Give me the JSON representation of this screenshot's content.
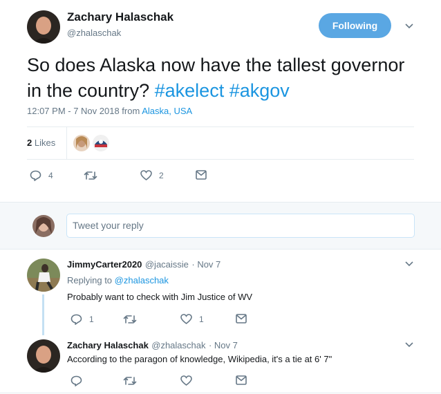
{
  "tweet": {
    "author_name": "Zachary Halaschak",
    "author_handle": "@zhalaschak",
    "follow_label": "Following",
    "text_plain": "So does Alaska now have the tallest governor in the country?",
    "hashtag_1": "#akelect",
    "hashtag_2": "#akgov",
    "timestamp": "12:07 PM - 7 Nov 2018 from",
    "location": "Alaska, USA",
    "likes_count": "2",
    "likes_label": "Likes",
    "reply_count": "4",
    "like_count": "2"
  },
  "reply_box": {
    "placeholder": "Tweet your reply"
  },
  "replies": [
    {
      "name": "JimmyCarter2020",
      "handle": "@jacaissie",
      "date": "· Nov 7",
      "replying_to_label": "Replying to",
      "replying_to": "@zhalaschak",
      "text": "Probably want to check with Jim Justice of WV",
      "reply_count": "1",
      "like_count": "1"
    },
    {
      "name": "Zachary Halaschak",
      "handle": "@zhalaschak",
      "date": "· Nov 7",
      "text": "According to the paragon of knowledge, Wikipedia, it's a tie at 6' 7\""
    }
  ],
  "colors": {
    "accent": "#1b95e0",
    "follow_bg": "#5aa7e3",
    "muted": "#657786",
    "divider": "#e6ecf0"
  },
  "icons": [
    "reply-icon",
    "retweet-icon",
    "heart-icon",
    "message-icon",
    "chevron-down-icon"
  ]
}
